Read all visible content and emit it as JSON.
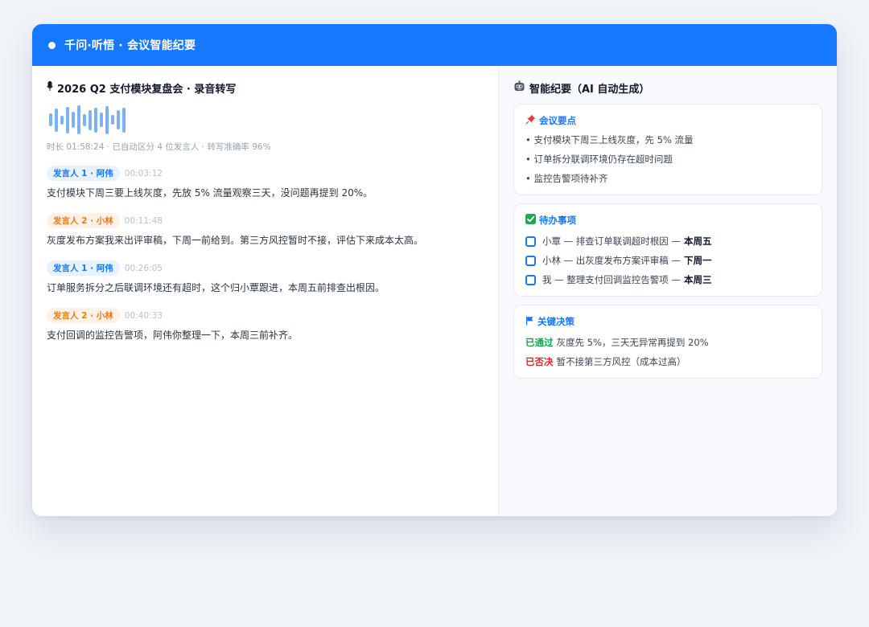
{
  "app": {
    "title": "千问·听悟 · 会议智能纪要"
  },
  "transcript": {
    "icon": "microphone-icon",
    "title": "2026 Q2 支付模块复盘会 · 录音转写",
    "waveform_levels": [
      0.4,
      0.72,
      0.28,
      0.82,
      0.5,
      0.9,
      0.38,
      0.62,
      0.78,
      0.46,
      0.88,
      0.3,
      0.6,
      0.78
    ],
    "meta": "时长 01:58:24 · 已自动区分 4 位发言人 · 转写准确率 96%",
    "utterances": [
      {
        "speaker": "发言人 1 · 阿伟",
        "time": "00:03:12",
        "text": "支付模块下周三要上线灰度，先放 5% 流量观察三天，没问题再提到 20%。"
      },
      {
        "speaker": "发言人 2 · 小林",
        "time": "00:11:48",
        "text": "灰度发布方案我来出评审稿，下周一前给到。第三方风控暂时不接，评估下来成本太高。"
      },
      {
        "speaker": "发言人 1 · 阿伟",
        "time": "00:26:05",
        "text": "订单服务拆分之后联调环境还有超时，这个归小覃跟进，本周五前排查出根因。"
      },
      {
        "speaker": "发言人 2 · 小林",
        "time": "00:40:33",
        "text": "支付回调的监控告警项，阿伟你整理一下，本周三前补齐。"
      }
    ],
    "colors": {
      "speaker1": "#1677ff",
      "speaker2": "#f07a1a"
    }
  },
  "summary": {
    "icon": "robot-face-icon",
    "title": "智能纪要（AI 自动生成）",
    "key_points": {
      "icon": "pushpin-icon",
      "title": "会议要点",
      "items": [
        "• 支付模块下周三上线灰度，先 5% 流量",
        "• 订单拆分联调环境仍存在超时问题",
        "• 监控告警项待补齐"
      ]
    },
    "todos": {
      "icon": "check-mark-icon",
      "title": "待办事项",
      "items": [
        {
          "text": "小覃 — 排查订单联调超时根因 —",
          "due": "本周五"
        },
        {
          "text": "小林 — 出灰度发布方案评审稿 —",
          "due": "下周一"
        },
        {
          "text": "我 — 整理支付回调监控告警项 —",
          "due": "本周三"
        }
      ]
    },
    "decisions": {
      "icon": "flag-icon",
      "title": "关键决策",
      "items": [
        {
          "status": "已通过",
          "text": "灰度先 5%，三天无异常再提到 20%",
          "color": "#16a34a"
        },
        {
          "status": "已否决",
          "text": "暂不接第三方风控（成本过高）",
          "color": "#dc2626"
        }
      ]
    }
  },
  "theme": {
    "accent": "#1677ff",
    "background": "#f0f3f8"
  }
}
